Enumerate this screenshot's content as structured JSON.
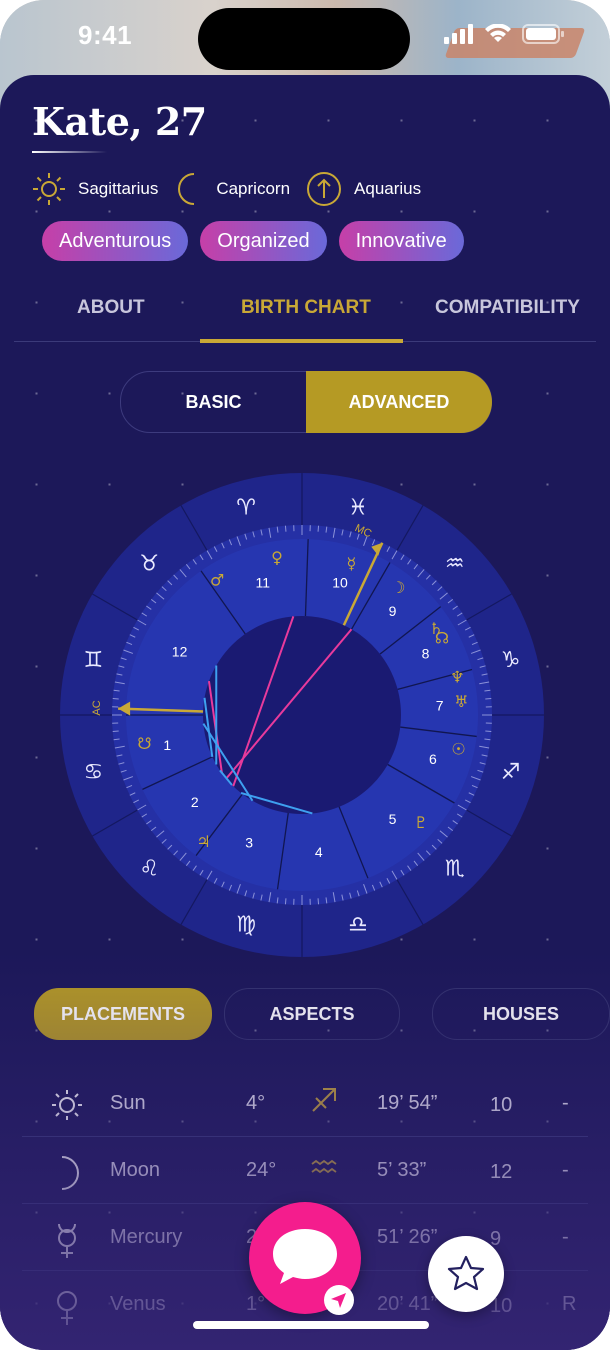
{
  "status": {
    "time": "9:41"
  },
  "profile": {
    "name": "Kate, 27",
    "signs": [
      {
        "icon": "sun-icon",
        "label": "Sagittarius"
      },
      {
        "icon": "moon-icon",
        "label": "Capricorn"
      },
      {
        "icon": "ascendant-icon",
        "label": "Aquarius"
      }
    ],
    "traits": [
      "Adventurous",
      "Organized",
      "Innovative"
    ]
  },
  "tabs": [
    "ABOUT",
    "BIRTH CHART",
    "COMPATIBILITY"
  ],
  "active_tab": "BIRTH CHART",
  "chart_mode": {
    "options": [
      "BASIC",
      "ADVANCED"
    ],
    "selected": "ADVANCED"
  },
  "wheel": {
    "zodiac_glyphs": [
      "♈",
      "♓",
      "♒",
      "♑",
      "♐",
      "♏",
      "♎",
      "♍",
      "♌",
      "♋",
      "♊",
      "♉"
    ],
    "houses": [
      "1",
      "2",
      "3",
      "4",
      "5",
      "6",
      "7",
      "8",
      "9",
      "10",
      "11",
      "12"
    ],
    "axis_labels": {
      "asc": "AC",
      "mc": "MC"
    },
    "planet_glyphs": [
      "♀",
      "☿",
      "☽",
      "♄",
      "☊",
      "♆",
      "♅",
      "☉",
      "♇",
      "♃",
      "☋",
      "♂"
    ],
    "accent": "#c9a836",
    "aspect_colors": [
      "#e83a9c",
      "#3ea0f0"
    ]
  },
  "placement_tabs": [
    "PLACEMENTS",
    "ASPECTS",
    "HOUSES"
  ],
  "active_placement_tab": "PLACEMENTS",
  "placements": [
    {
      "planet": "Sun",
      "icon": "sun-icon",
      "degree": "4°",
      "sign_glyph": "♐",
      "sign_icon": "sagittarius-icon",
      "minutes": "19’ 54”",
      "house": "10",
      "retro": "-"
    },
    {
      "planet": "Moon",
      "icon": "moon-icon",
      "degree": "24°",
      "sign_glyph": "♒",
      "sign_icon": "aquarius-icon",
      "minutes": "5’ 33”",
      "house": "12",
      "retro": "-"
    },
    {
      "planet": "Mercury",
      "icon": "mercury-icon",
      "degree": "2°",
      "sign_glyph": "♒",
      "sign_icon": "aquarius-icon",
      "minutes": "51’ 26”",
      "house": "9",
      "retro": "-"
    },
    {
      "planet": "Venus",
      "icon": "venus-icon",
      "degree": "1°",
      "sign_glyph": "♓",
      "sign_icon": "pisces-icon",
      "minutes": "20’ 41”",
      "house": "10",
      "retro": "R"
    }
  ]
}
